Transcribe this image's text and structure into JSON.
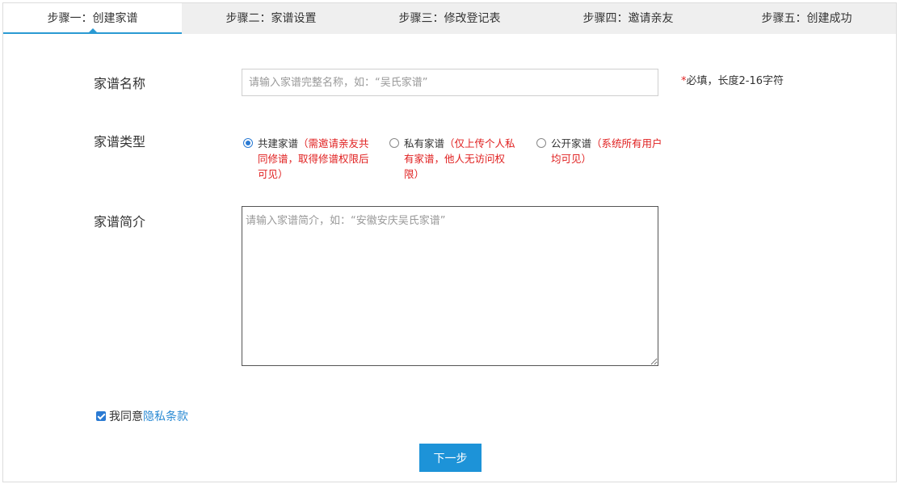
{
  "steps": [
    {
      "label": "步骤一：创建家谱",
      "active": true
    },
    {
      "label": "步骤二：家谱设置",
      "active": false
    },
    {
      "label": "步骤三：修改登记表",
      "active": false
    },
    {
      "label": "步骤四：邀请亲友",
      "active": false
    },
    {
      "label": "步骤五：创建成功",
      "active": false
    }
  ],
  "form": {
    "name_label": "家谱名称",
    "name_placeholder": "请输入家谱完整名称，如：“吴氏家谱”",
    "name_hint_star": "*",
    "name_hint": "必填，长度2-16字符",
    "type_label": "家谱类型",
    "types": [
      {
        "name": "共建家谱",
        "desc": "（需邀请亲友共同修谱，取得修谱权限后可见）",
        "checked": true
      },
      {
        "name": "私有家谱",
        "desc": "（仅上传个人私有家谱，他人无访问权限）",
        "checked": false
      },
      {
        "name": "公开家谱",
        "desc": "（系统所有用户均可见）",
        "checked": false
      }
    ],
    "intro_label": "家谱简介",
    "intro_placeholder": "请输入家谱简介，如：“安徽安庆吴氏家谱”",
    "agree_text": "我同意",
    "agree_link": "隐私条款",
    "agree_checked": true,
    "next_label": "下一步"
  },
  "colors": {
    "accent": "#2a9ad3",
    "button": "#1d93d8",
    "warning": "#e02020"
  }
}
